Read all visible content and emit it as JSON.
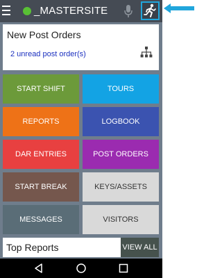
{
  "header": {
    "site_name": "_MASTERSITE",
    "status_color": "#59c135",
    "icons": [
      "menu-icon",
      "status-dot-icon",
      "microphone-icon",
      "running-person-icon"
    ]
  },
  "post_orders": {
    "title": "New Post Orders",
    "unread_text": "2 unread post order(s)",
    "icon": "hierarchy-icon"
  },
  "tiles": [
    {
      "label": "START SHIFT",
      "color": "#6c9a3a"
    },
    {
      "label": "TOURS",
      "color": "#13a3e4"
    },
    {
      "label": "REPORTS",
      "color": "#ee7217"
    },
    {
      "label": "LOGBOOK",
      "color": "#3b53b0"
    },
    {
      "label": "DAR ENTRIES",
      "color": "#e84040"
    },
    {
      "label": "POST ORDERS",
      "color": "#9b2bb0"
    },
    {
      "label": "START BREAK",
      "color": "#75574d"
    },
    {
      "label": "KEYS/ASSETS",
      "color": "#d9d9d9"
    },
    {
      "label": "MESSAGES",
      "color": "#5a6d77"
    },
    {
      "label": "VISITORS",
      "color": "#d9d9d9"
    }
  ],
  "top_reports": {
    "label": "Top Reports",
    "view_all_label": "VIEW ALL"
  },
  "nav": {
    "icons": [
      "back-icon",
      "home-icon",
      "recents-icon"
    ]
  },
  "accent_color": "#21a6dc"
}
